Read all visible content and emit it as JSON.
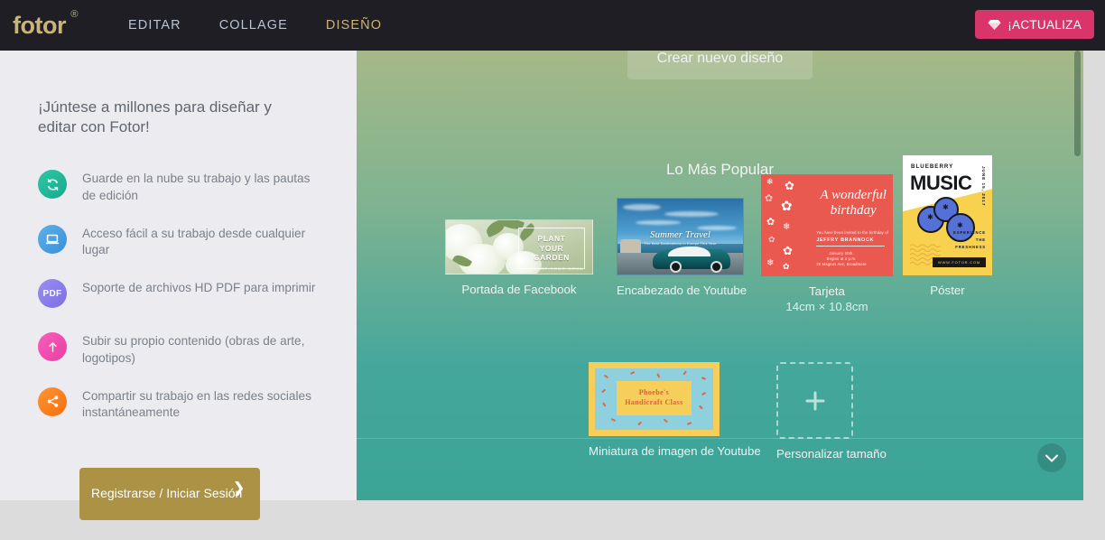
{
  "nav": {
    "logo": "fotor",
    "logo_reg": "®",
    "items": [
      {
        "label": "EDITAR",
        "active": false
      },
      {
        "label": "COLLAGE",
        "active": false
      },
      {
        "label": "DISEÑO",
        "active": true
      }
    ],
    "upgrade_label": "¡ACTUALIZA",
    "upgrade_color": "#d9356b",
    "accent_color": "#cbb477",
    "bar_color": "#1e1e24"
  },
  "sidebar": {
    "title": "¡Júntese a millones para diseñar y editar con Fotor!",
    "features": [
      {
        "icon": "cloud-sync-icon",
        "color": "#22b79a",
        "text": "Guarde en la nube su trabajo y las pautas de edición"
      },
      {
        "icon": "laptop-icon",
        "color": "#4a9fe0",
        "text": "Acceso fácil a su trabajo desde cualquier lugar"
      },
      {
        "icon": "pdf-icon",
        "color": "#8a7fe8",
        "label": "PDF",
        "text": "Soporte de archivos HD PDF para imprimir"
      },
      {
        "icon": "upload-arrow-icon",
        "color": "#ef4fb0",
        "text": "Subir su propio contenido (obras de arte, logotipos)"
      },
      {
        "icon": "share-icon",
        "color": "#f87a1e",
        "text": "Compartir su trabajo en las redes sociales instantáneamente"
      }
    ],
    "signup_label": "Registrarse / Iniciar Sesión",
    "signup_chevron": "❯",
    "signup_color": "#ab9244"
  },
  "main": {
    "create_label": "Crear nuevo diseño",
    "section_title": "Lo Más Popular",
    "scroll_down_icon": "chevron-down-icon",
    "cards": [
      {
        "label": "Portada de Facebook",
        "sub": "",
        "art": {
          "headline_l1": "PLANT",
          "headline_l2": "YOUR",
          "headline_l3": "GARDEN",
          "tagline": "PLANT YOUR SOUL"
        }
      },
      {
        "label": "Encabezado de Youtube",
        "sub": "",
        "art": {
          "title": "Summer Travel",
          "subtitle": "The Best Destinations in Europe This Year"
        }
      },
      {
        "label": "Tarjeta",
        "sub": "14cm × 10.8cm",
        "art": {
          "title_l1": "A wonderful",
          "title_l2": "birthday",
          "invite_line": "You have been invited to the birthday of",
          "name": "JEFFRY BRANNOCK",
          "detail_l1": "January 20th.",
          "detail_l2": "Begins at 4 p.m.",
          "detail_l3": "29 Magnus Ave, Broadmore"
        }
      },
      {
        "label": "Póster",
        "sub": "",
        "art": {
          "brand": "BLUEBERRY",
          "title": "MUSIC",
          "date": "JUNE 15, 2017",
          "tag_l1": "EXPERIENCE",
          "tag_l2": "THE",
          "tag_l3": "FRESHNESS",
          "url": "WWW.FOTOR.COM"
        }
      },
      {
        "label": "Miniatura de imagen de Youtube",
        "sub": "",
        "art": {
          "title_l1": "Phoebe's",
          "title_l2": "Handicraft Class"
        }
      },
      {
        "label": "Personalizar tamaño",
        "sub": "",
        "art": {
          "icon": "plus-icon"
        }
      }
    ]
  }
}
